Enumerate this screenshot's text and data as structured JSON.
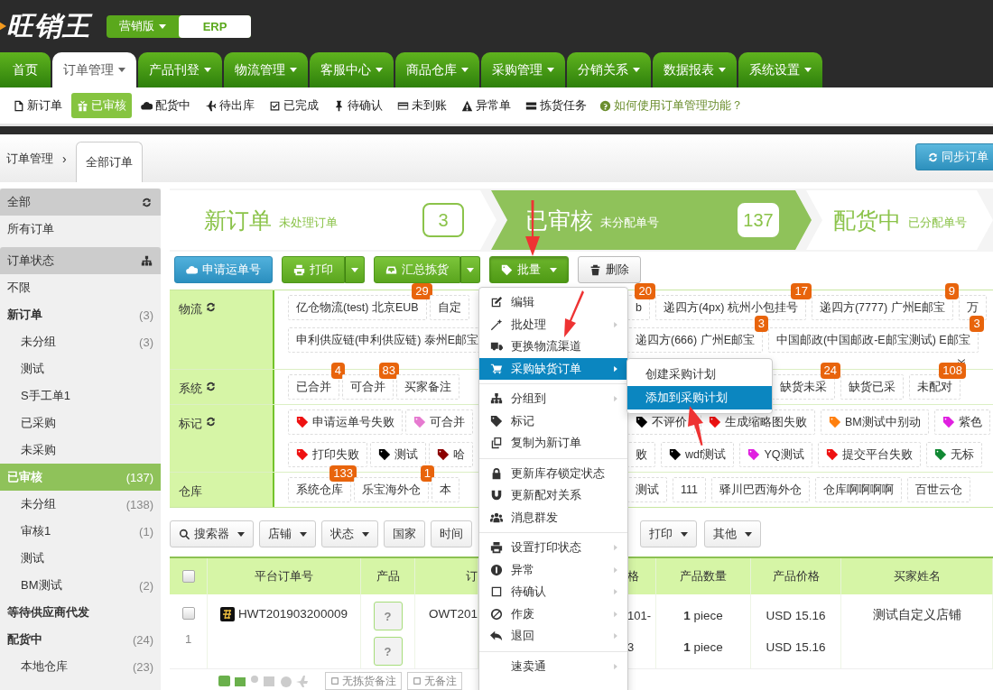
{
  "logo": {
    "text": "旺销王"
  },
  "edition": [
    {
      "label": "营销版",
      "dropdown": true,
      "selected": false
    },
    {
      "label": "ERP",
      "dropdown": false,
      "selected": true
    }
  ],
  "main_nav": [
    {
      "label": "首页",
      "selected": false,
      "dropdown": false
    },
    {
      "label": "订单管理",
      "selected": true,
      "dropdown": true
    },
    {
      "label": "产品刊登",
      "selected": false,
      "dropdown": true
    },
    {
      "label": "物流管理",
      "selected": false,
      "dropdown": true
    },
    {
      "label": "客服中心",
      "selected": false,
      "dropdown": true
    },
    {
      "label": "商品仓库",
      "selected": false,
      "dropdown": true
    },
    {
      "label": "采购管理",
      "selected": false,
      "dropdown": true
    },
    {
      "label": "分销关系",
      "selected": false,
      "dropdown": true
    },
    {
      "label": "数据报表",
      "selected": false,
      "dropdown": true
    },
    {
      "label": "系统设置",
      "selected": false,
      "dropdown": true
    }
  ],
  "sub_nav": [
    {
      "label": "新订单",
      "selected": false
    },
    {
      "label": "已审核",
      "selected": true
    },
    {
      "label": "配货中",
      "selected": false
    },
    {
      "label": "待出库",
      "selected": false
    },
    {
      "label": "已完成",
      "selected": false
    },
    {
      "label": "待确认",
      "selected": false
    },
    {
      "label": "未到账",
      "selected": false
    },
    {
      "label": "异常单",
      "selected": false
    },
    {
      "label": "拣货任务",
      "selected": false
    }
  ],
  "help_link": "如何使用订单管理功能？",
  "breadcrumb": {
    "parent": "订单管理",
    "separator": "›",
    "tab": "全部订单"
  },
  "sync_button": "同步订单",
  "sidebar": [
    {
      "kind": "header",
      "label": "全部"
    },
    {
      "kind": "item",
      "label": "所有订单",
      "selected": false
    },
    {
      "kind": "header",
      "label": "订单状态"
    },
    {
      "kind": "item",
      "label": "不限",
      "selected": false
    },
    {
      "kind": "group",
      "label": "新订单",
      "count": "(3)",
      "selected": false,
      "children": [
        {
          "label": "未分组",
          "count": "(3)",
          "selected": false
        },
        {
          "label": "测试",
          "selected": false
        },
        {
          "label": "S手工单1",
          "selected": false
        },
        {
          "label": "已采购",
          "selected": false
        },
        {
          "label": "未采购",
          "selected": false
        }
      ]
    },
    {
      "kind": "group",
      "label": "已审核",
      "count": "(137)",
      "selected": true,
      "children": [
        {
          "label": "未分组",
          "count": "(138)",
          "selected": false
        },
        {
          "label": "审核1",
          "count": "(1)",
          "selected": false
        },
        {
          "label": "测试",
          "selected": false
        },
        {
          "label": "BM测试",
          "count": "(2)",
          "selected": false
        }
      ]
    },
    {
      "kind": "group",
      "label": "等待供应商代发",
      "selected": false
    },
    {
      "kind": "group",
      "label": "配货中",
      "count": "(24)",
      "selected": false,
      "children": [
        {
          "label": "本地仓库",
          "count": "(23)",
          "selected": false
        }
      ]
    }
  ],
  "steps": [
    {
      "title": "新订单",
      "subtitle": "未处理订单",
      "count": "3",
      "selected": false
    },
    {
      "title": "已审核",
      "subtitle": "未分配单号",
      "count": "137",
      "selected": true
    },
    {
      "title": "配货中",
      "subtitle": "已分配单号",
      "selected": false
    }
  ],
  "actions": [
    {
      "kind": "primary",
      "label": "申请运单号"
    },
    {
      "kind": "split",
      "label": "打印"
    },
    {
      "kind": "split",
      "label": "汇总拣货"
    },
    {
      "kind": "dropdown",
      "label": "批量",
      "expanded": true
    },
    {
      "kind": "plain",
      "label": "删除"
    }
  ],
  "filters": [
    {
      "label": "物流",
      "refreshable": true,
      "collapsible": true,
      "lines": [
        {
          "left": [
            {
              "kind": "plain",
              "label": "亿仓物流(test) 北京EUB",
              "badge": "29"
            },
            {
              "kind": "plain",
              "label": "自定"
            }
          ],
          "right": [
            {
              "kind": "plain",
              "label": "b",
              "badge": "20"
            },
            {
              "kind": "plain",
              "label": "递四方(4px) 杭州小包挂号",
              "badge": "17"
            },
            {
              "kind": "plain",
              "label": "递四方(7777) 广州E邮宝",
              "badge": "9"
            },
            {
              "kind": "plain",
              "label": "万"
            }
          ]
        },
        {
          "left": [
            {
              "kind": "plain",
              "label": "申利供应链(申利供应链) 泰州E邮宝"
            }
          ],
          "right": [
            {
              "kind": "plain",
              "label": "递四方(666) 广州E邮宝",
              "badge": "3"
            },
            {
              "kind": "plain",
              "label": "中国邮政(中国邮政-E邮宝测试) E邮宝",
              "badge": "3"
            }
          ]
        }
      ]
    },
    {
      "label": "系统",
      "refreshable": true,
      "collapsible": false,
      "lines": [
        {
          "left": [
            {
              "kind": "plain",
              "label": "已合并",
              "badge": "4"
            },
            {
              "kind": "plain",
              "label": "可合并",
              "badge": "83"
            },
            {
              "kind": "plain",
              "label": "买家备注"
            }
          ],
          "right": [
            {
              "kind": "plain",
              "label": "缺货未采",
              "badge": "24"
            },
            {
              "kind": "plain",
              "label": "缺货已采"
            },
            {
              "kind": "plain",
              "label": "未配对",
              "badge": "108"
            }
          ]
        }
      ]
    },
    {
      "label": "标记",
      "refreshable": true,
      "collapsible": false,
      "lines": [
        {
          "left": [
            {
              "kind": "tag",
              "label": "申请运单号失败",
              "color": "#ee1111"
            },
            {
              "kind": "tag",
              "label": "可合并",
              "color": "#e67ad0"
            }
          ],
          "right": [
            {
              "kind": "tag",
              "label": "不评价",
              "color": "#000000"
            },
            {
              "kind": "tag",
              "label": "生成缩略图失败",
              "color": "#ee1111"
            },
            {
              "kind": "tag",
              "label": "BM测试中别动",
              "color": "#ff7f0e"
            },
            {
              "kind": "tag",
              "label": "紫色",
              "color": "#e020e0"
            }
          ]
        },
        {
          "left": [
            {
              "kind": "tag",
              "label": "打印失败",
              "color": "#ee1111"
            },
            {
              "kind": "tag",
              "label": "测试",
              "color": "#000000"
            },
            {
              "kind": "tag",
              "label": "哈",
              "color": "#8b0000"
            }
          ],
          "right": [
            {
              "kind": "plain",
              "label": "败"
            },
            {
              "kind": "tag",
              "label": "wdf测试",
              "color": "#000000"
            },
            {
              "kind": "tag",
              "label": "YQ测试",
              "color": "#e020e0"
            },
            {
              "kind": "tag",
              "label": "提交平台失败",
              "color": "#ee1111"
            },
            {
              "kind": "tag",
              "label": "无标",
              "color": "#118833"
            }
          ]
        }
      ]
    },
    {
      "label": "仓库",
      "refreshable": false,
      "collapsible": false,
      "lines": [
        {
          "left": [
            {
              "kind": "plain",
              "label": "系统仓库",
              "badge": "133"
            },
            {
              "kind": "plain",
              "label": "乐宝海外仓",
              "badge": "1"
            },
            {
              "kind": "plain",
              "label": "本"
            }
          ],
          "right": [
            {
              "kind": "plain",
              "label": "测试"
            },
            {
              "kind": "plain",
              "label": "111"
            },
            {
              "kind": "plain",
              "label": "驿川巴西海外仓"
            },
            {
              "kind": "plain",
              "label": "仓库啊啊啊啊"
            },
            {
              "kind": "plain",
              "label": "百世云仓"
            }
          ]
        }
      ]
    }
  ],
  "search_tools": {
    "left": [
      {
        "label": "搜索器",
        "dropdown": true
      },
      {
        "label": "店铺",
        "dropdown": true
      },
      {
        "label": "状态",
        "dropdown": true
      },
      {
        "label": "国家",
        "dropdown": false
      },
      {
        "label": "时间",
        "dropdown": false
      }
    ],
    "right": [
      {
        "label": "打印",
        "dropdown": true
      },
      {
        "label": "其他",
        "dropdown": true
      }
    ]
  },
  "table": {
    "header_checked": false,
    "columns_left": [
      "平台订单号",
      "产品",
      "订"
    ],
    "columns_right": [
      "格",
      "产品数量",
      "产品价格",
      "买家姓名"
    ],
    "rows": [
      {
        "checked": false,
        "index": "1",
        "order_no": "HWT201903200009",
        "products": [
          "?",
          "?"
        ],
        "column_4": "OWT201",
        "column_5": [
          "101-",
          "3"
        ],
        "quantities": [
          "**1** piece",
          "**1** piece"
        ],
        "prices": [
          "USD 15.16",
          "USD 15.16"
        ],
        "buyer": "测试自定义店铺",
        "notes": [
          "无拣货备注",
          "无备注"
        ]
      }
    ]
  },
  "menu": [
    {
      "kind": "item",
      "label": "编辑",
      "submenu": false,
      "selected": false
    },
    {
      "kind": "item",
      "label": "批处理",
      "submenu": true,
      "selected": false
    },
    {
      "kind": "item",
      "label": "更换物流渠道",
      "submenu": false,
      "selected": false
    },
    {
      "kind": "item",
      "label": "采购缺货订单",
      "submenu": true,
      "selected": true
    },
    {
      "kind": "divider"
    },
    {
      "kind": "item",
      "label": "分组到",
      "submenu": true,
      "selected": false
    },
    {
      "kind": "item",
      "label": "标记",
      "submenu": false,
      "selected": false
    },
    {
      "kind": "item",
      "label": "复制为新订单",
      "submenu": false,
      "selected": false
    },
    {
      "kind": "divider"
    },
    {
      "kind": "item",
      "label": "更新库存锁定状态",
      "submenu": false,
      "selected": false
    },
    {
      "kind": "item",
      "label": "更新配对关系",
      "submenu": false,
      "selected": false
    },
    {
      "kind": "item",
      "label": "消息群发",
      "submenu": false,
      "selected": false
    },
    {
      "kind": "divider"
    },
    {
      "kind": "item",
      "label": "设置打印状态",
      "submenu": true,
      "selected": false
    },
    {
      "kind": "item",
      "label": "异常",
      "submenu": true,
      "selected": false
    },
    {
      "kind": "item",
      "label": "待确认",
      "submenu": true,
      "selected": false
    },
    {
      "kind": "item",
      "label": "作废",
      "submenu": true,
      "selected": false
    },
    {
      "kind": "item",
      "label": "退回",
      "submenu": true,
      "selected": false
    },
    {
      "kind": "divider"
    },
    {
      "kind": "item",
      "label": "速卖通",
      "submenu": true,
      "selected": false
    }
  ],
  "submenu": [
    {
      "label": "创建采购计划",
      "selected": false
    },
    {
      "label": "添加到采购计划",
      "selected": true
    }
  ]
}
